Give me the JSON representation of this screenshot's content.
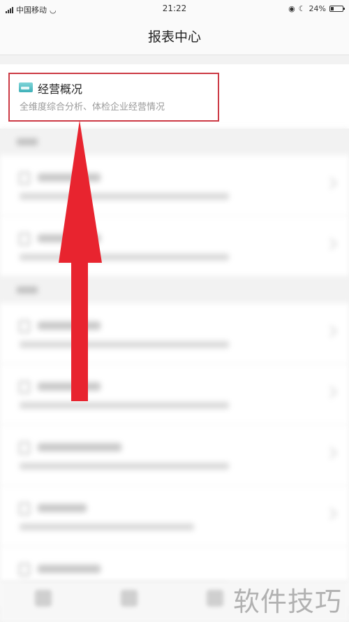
{
  "status_bar": {
    "carrier": "中国移动",
    "time": "21:22",
    "battery": "24%",
    "battery_level": 0.24
  },
  "nav": {
    "title": "报表中心"
  },
  "overview": {
    "icon": "report-card-icon",
    "title": "经营概况",
    "subtitle": "全维度综合分析、体检企业经营情况"
  },
  "watermark": "软件技巧",
  "colors": {
    "highlight": "#cc3a45",
    "arrow": "#e8242f"
  }
}
